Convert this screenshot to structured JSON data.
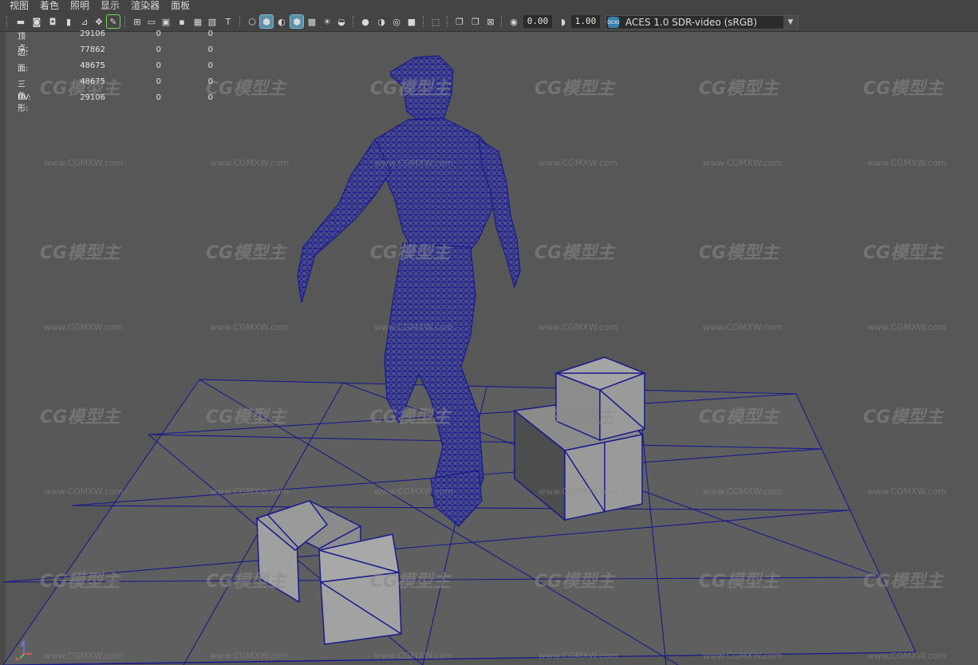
{
  "menu": [
    "视图",
    "着色",
    "照明",
    "显示",
    "渲染器",
    "面板"
  ],
  "toolbar": {
    "exposure_value": "0.00",
    "gamma_value": "1.00",
    "color_space": "ACES 1.0 SDR-video (sRGB)",
    "color_space_badge": "OCIO"
  },
  "hud_stats": [
    {
      "label": "顶点:",
      "values": [
        "29106",
        "0",
        "0"
      ]
    },
    {
      "label": "边:",
      "values": [
        "77862",
        "0",
        "0"
      ]
    },
    {
      "label": "面:",
      "values": [
        "48675",
        "0",
        "0"
      ]
    },
    {
      "label": "三角形:",
      "values": [
        "48675",
        "0",
        "0"
      ]
    },
    {
      "label": "UV:",
      "values": [
        "29106",
        "0",
        "0"
      ]
    }
  ],
  "watermark": {
    "logo": "CG模型主",
    "url": "www.CGMXW.com"
  },
  "axis": {
    "z": "z",
    "x": "x"
  },
  "colors": {
    "wireframe": "#1a1a8c",
    "viewport_bg": "#575757",
    "toolbar_bg": "#444444"
  }
}
